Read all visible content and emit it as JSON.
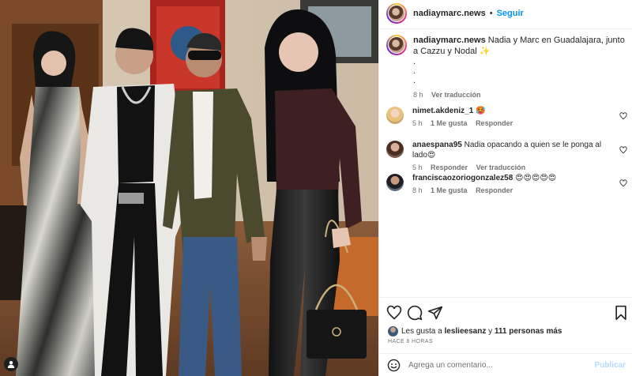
{
  "post": {
    "username": "nadiaymarc.news",
    "separator": "•",
    "follow_label": "Seguir",
    "caption_user": "nadiaymarc.news",
    "caption_text": "Nadia y Marc en Guadalajara, junto a Cazzu y Nodal",
    "caption_emoji": "✨",
    "caption_dots": [
      ".",
      ".",
      "."
    ],
    "time": "8 h",
    "translate_label": "Ver traducción"
  },
  "comments": [
    {
      "user": "nimet.akdeniz_1",
      "text": "🥵",
      "time": "5 h",
      "likes": "1 Me gusta",
      "reply": "Responder",
      "translate": ""
    },
    {
      "user": "anaespana95",
      "text": "Nadia opacando a quien se le ponga al lado😍",
      "time": "5 h",
      "likes": "",
      "reply": "Responder",
      "translate": "Ver traducción"
    },
    {
      "user": "franciscaozoriogonzalez58",
      "text": "😍😍😍😍😍",
      "time": "8 h",
      "likes": "1 Me gusta",
      "reply": "Responder",
      "translate": ""
    }
  ],
  "likes_line": {
    "prefix": "Les gusta a",
    "user": "leslieesanz",
    "conjunction": "y",
    "others": "111 personas más"
  },
  "posted_ago": "HACE 8 HORAS",
  "add_comment": {
    "placeholder": "Agrega un comentario...",
    "publish_label": "Publicar"
  },
  "icons": {
    "like": "heart-icon",
    "comment": "comment-icon",
    "share": "send-icon",
    "save": "bookmark-icon",
    "emoji": "emoji-icon",
    "tag": "user-tag-icon"
  },
  "colors": {
    "accent": "#0095f6",
    "publish_disabled": "#b3dbff",
    "muted": "#737373",
    "text": "#262626"
  }
}
